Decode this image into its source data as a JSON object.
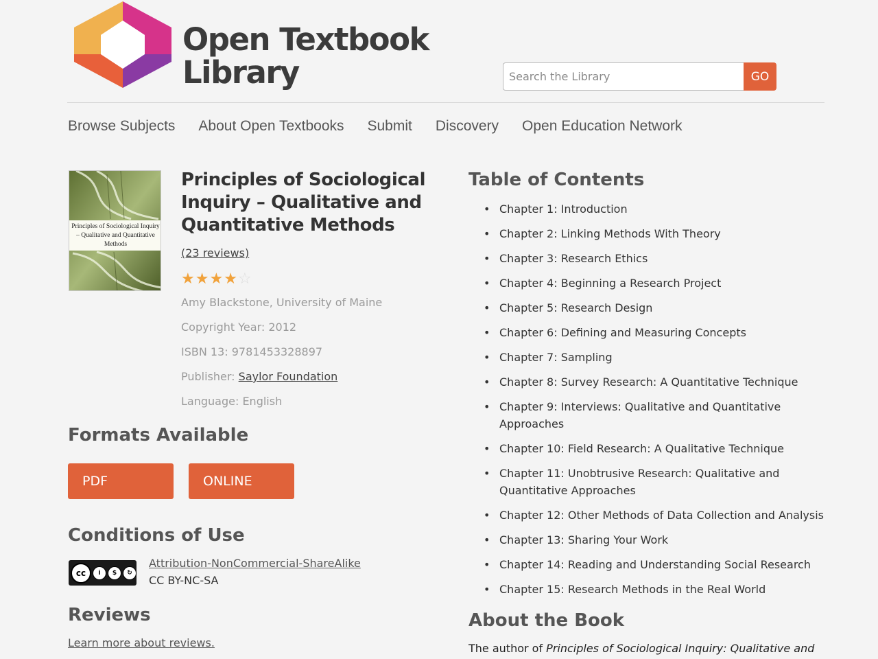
{
  "site": {
    "logo_line1": "Open Textbook",
    "logo_line2": "Library",
    "colors": {
      "accent": "#e0623a",
      "logo_yellow": "#f0b14f",
      "logo_magenta": "#d6338a",
      "logo_orange": "#e8603a",
      "logo_purple": "#8a3aa3"
    }
  },
  "search": {
    "placeholder": "Search the Library",
    "button_label": "GO"
  },
  "nav": {
    "items": [
      "Browse Subjects",
      "About Open Textbooks",
      "Submit",
      "Discovery",
      "Open Education Network"
    ]
  },
  "book": {
    "cover_title": "Principles of Sociological Inquiry – Qualitative and Quantitative Methods",
    "title": "Principles of Sociological Inquiry – Qualitative and Quantitative Methods",
    "reviews_link": "(23 reviews)",
    "rating": 4,
    "rating_max": 5,
    "author": "Amy Blackstone, University of Maine",
    "copyright": "Copyright Year: 2012",
    "isbn": "ISBN 13: 9781453328897",
    "publisher_label": "Publisher: ",
    "publisher": "Saylor Foundation",
    "language": "Language: English"
  },
  "formats": {
    "heading": "Formats Available",
    "buttons": [
      "PDF",
      "ONLINE"
    ]
  },
  "conditions": {
    "heading": "Conditions of Use",
    "badge_icons": [
      "cc-icon",
      "by-icon",
      "nc-icon",
      "sa-icon"
    ],
    "license_link": "Attribution-NonCommercial-ShareAlike",
    "license_abbr": "CC BY-NC-SA"
  },
  "reviews": {
    "heading": "Reviews",
    "learn_more": "Learn more about reviews."
  },
  "toc": {
    "heading": "Table of Contents",
    "items": [
      "Chapter 1: Introduction",
      "Chapter 2: Linking Methods With Theory",
      "Chapter 3: Research Ethics",
      "Chapter 4: Beginning a Research Project",
      "Chapter 5: Research Design",
      "Chapter 6: Defining and Measuring Concepts",
      "Chapter 7: Sampling",
      "Chapter 8: Survey Research: A Quantitative Technique",
      "Chapter 9: Interviews: Qualitative and Quantitative Approaches",
      "Chapter 10: Field Research: A Qualitative Technique",
      "Chapter 11: Unobtrusive Research: Qualitative and Quantitative Approaches",
      "Chapter 12: Other Methods of Data Collection and Analysis",
      "Chapter 13: Sharing Your Work",
      "Chapter 14: Reading and Understanding Social Research",
      "Chapter 15: Research Methods in the Real World"
    ]
  },
  "about": {
    "heading": "About the Book",
    "text_prefix": "The author of ",
    "text_italic": "Principles of Sociological Inquiry: Qualitative and"
  }
}
